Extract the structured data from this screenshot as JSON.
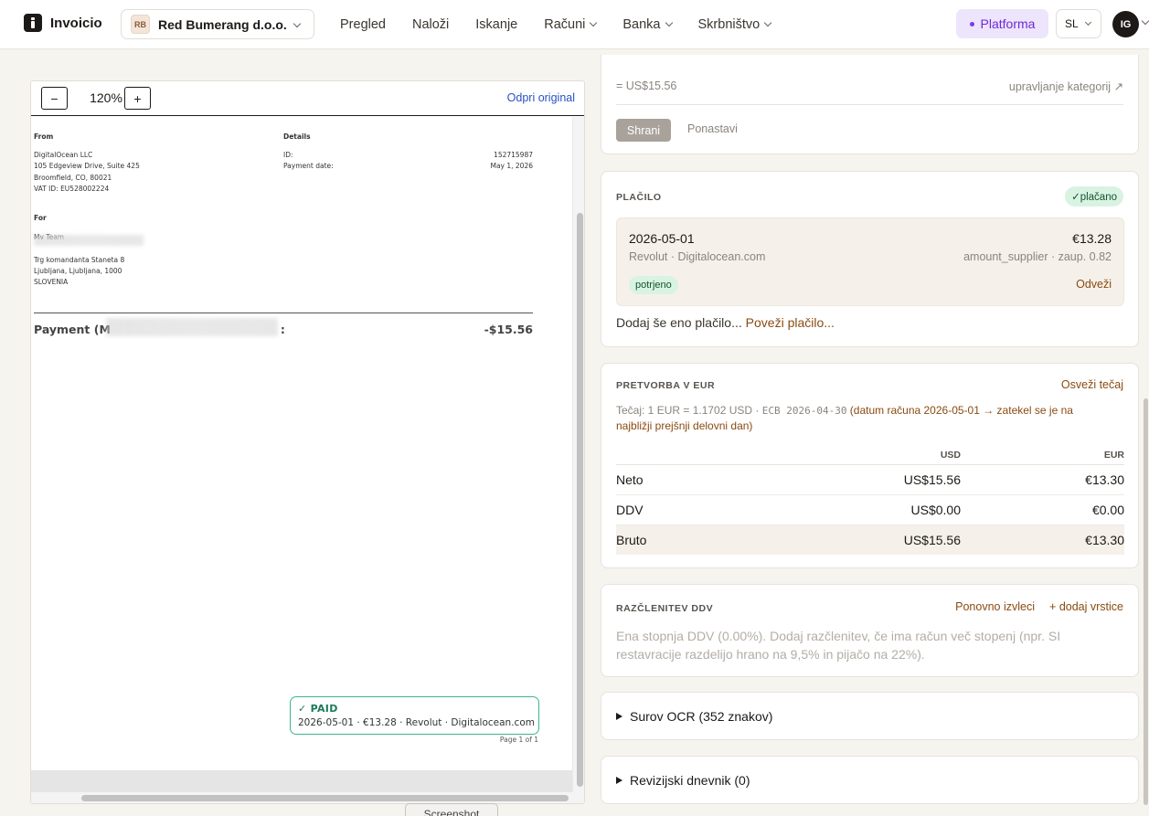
{
  "app": {
    "name": "Invoicio"
  },
  "company": {
    "initials": "RB",
    "name": "Red Bumerang d.o.o."
  },
  "nav": {
    "items": [
      "Pregled",
      "Naloži",
      "Iskanje",
      "Računi",
      "Banka",
      "Skrbništvo"
    ]
  },
  "platform": {
    "label": "Platforma"
  },
  "lang": {
    "code": "SL"
  },
  "user": {
    "initials": "IG"
  },
  "viewer": {
    "zoom": "120%",
    "zoom_out": "−",
    "zoom_in": "+",
    "open_original": "Odpri original",
    "screenshot_tab": "Screenshot"
  },
  "invoice": {
    "from_label": "From",
    "from_lines": [
      "DigitalOcean LLC",
      "105 Edgeview Drive, Suite 425",
      "Broomfield, CO, 80021",
      "VAT ID: EU528002224"
    ],
    "details_label": "Details",
    "id_label": "ID:",
    "id_value": "152715987",
    "payment_date_label": "Payment date:",
    "payment_date_value": "May 1, 2026",
    "for_label": "For",
    "for_name": "My Team",
    "for_lines": [
      "Trg komandanta Staneta 8",
      "Ljubljana, Ljubljana, 1000",
      "SLOVENIA"
    ],
    "payment_label_start": "Payment (M",
    "payment_label_end": ":",
    "payment_amount": "-$15.56",
    "stamp_title": "✓ PAID",
    "stamp_sub": "2026-05-01 · €13.28 · Revolut · Digitalocean.com",
    "page_no": "Page 1 of 1"
  },
  "categories_card": {
    "amount": "= US$15.56",
    "manage_link": "upravljanje kategorij ↗",
    "save_button": "Shrani",
    "reset_button": "Ponastavi"
  },
  "payment_card": {
    "label": "PLAČILO",
    "status_badge": "✓plačano",
    "date": "2026-05-01",
    "amount": "€13.28",
    "source": "Revolut · Digitalocean.com",
    "meta": "amount_supplier · zaup. 0.82",
    "confirmed_pill": "potrjeno",
    "unlink": "Odveži",
    "add_text": "Dodaj še eno plačilo...",
    "link_payment": "Poveži plačilo..."
  },
  "fx_card": {
    "label": "PRETVORBA V EUR",
    "refresh": "Osveži tečaj",
    "rate_text": "Tečaj: 1 EUR = 1.1702 USD · ",
    "rate_source": "ECB 2026-04-30",
    "rate_note": " (datum računa 2026-05-01 → zatekel se je na najbližji prejšnji delovni dan)",
    "columns": [
      "",
      "USD",
      "EUR"
    ],
    "rows": [
      {
        "label": "Neto",
        "usd": "US$15.56",
        "eur": "€13.30"
      },
      {
        "label": "DDV",
        "usd": "US$0.00",
        "eur": "€0.00"
      },
      {
        "label": "Bruto",
        "usd": "US$15.56",
        "eur": "€13.30"
      }
    ]
  },
  "vat_card": {
    "label": "RAZČLENITEV DDV",
    "re_extract": "Ponovno izvleci",
    "add_rows": "+ dodaj vrstice",
    "note": "Ena stopnja DDV (0.00%). Dodaj razčlenitev, če ima račun več stopenj (npr. SI restavracije razdelijo hrano na 9,5% in pijačo na 22%)."
  },
  "ocr_card": {
    "title": "Surov OCR (352 znakov)"
  },
  "audit_card": {
    "title": "Revizijski dnevnik (0)"
  }
}
